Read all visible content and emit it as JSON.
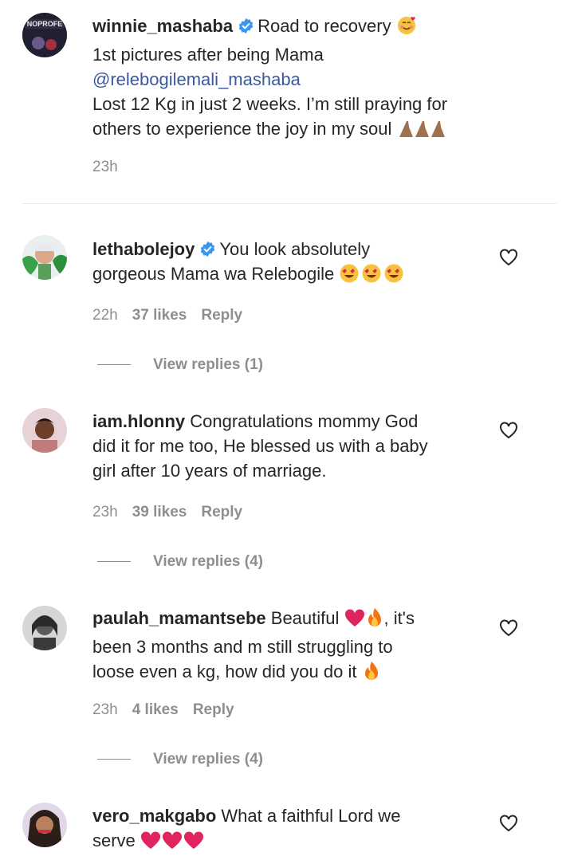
{
  "caption": {
    "username": "winnie_mashaba",
    "line1": "Road to recovery",
    "line2": "1st pictures after being Mama",
    "mention": "@relebogilemali_mashaba",
    "line3": "Lost 12 Kg in just 2 weeks. I’m still praying for",
    "line4": "others to experience the joy in my soul",
    "time": "23h",
    "avatar_text": "NOPROFE"
  },
  "comments": [
    {
      "username": "lethabolejoy",
      "text_a": "You look absolutely",
      "text_b": "gorgeous Mama wa Relebogile",
      "time": "22h",
      "likes": "37 likes",
      "reply": "Reply",
      "view_replies": "View replies (1)"
    },
    {
      "username": "iam.hlonny",
      "text_a": "Congratulations mommy God",
      "text_b": "did it for me too, He blessed us with a baby",
      "text_c": "girl after 10 years of marriage.",
      "time": "23h",
      "likes": "39 likes",
      "reply": "Reply",
      "view_replies": "View replies (4)"
    },
    {
      "username": "paulah_mamantsebe",
      "text_a": "Beautiful",
      "text_a2": ", it's",
      "text_b": "been 3 months and m still struggling to",
      "text_c": "loose even a kg, how did you do it",
      "time": "23h",
      "likes": "4 likes",
      "reply": "Reply",
      "view_replies": "View replies (4)"
    },
    {
      "username": "vero_makgabo",
      "text_a": "What a faithful Lord we",
      "text_b": "serve"
    }
  ],
  "colors": {
    "text": "#262626",
    "meta": "#8e8e8e",
    "link": "#3b5998",
    "verified": "#3897f0",
    "heart_red": "#e0245e"
  }
}
